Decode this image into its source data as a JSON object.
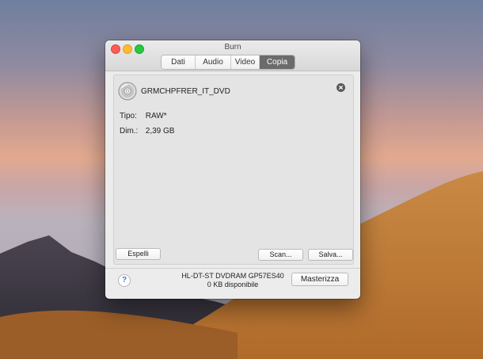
{
  "window": {
    "title": "Burn",
    "tabs": [
      {
        "label": "Dati",
        "active": false
      },
      {
        "label": "Audio",
        "active": false
      },
      {
        "label": "Video",
        "active": false
      },
      {
        "label": "Copia",
        "active": true
      }
    ]
  },
  "disc": {
    "name": "GRMCHPFRER_IT_DVD",
    "type_label": "Tipo:",
    "type_value": "RAW*",
    "size_label": "Dim.:",
    "size_value": "2,39 GB"
  },
  "buttons": {
    "eject": "Espelli",
    "scan": "Scan...",
    "save": "Salva...",
    "burn": "Masterizza",
    "help": "?"
  },
  "drive": {
    "name": "HL-DT-ST DVDRAM GP57ES40",
    "free": "0 KB disponibile"
  },
  "icons": {
    "disc": "disc-icon",
    "remove": "remove-circle-icon",
    "help": "help-icon"
  },
  "colors": {
    "active_tab": "#6b6b6b",
    "close": "#fc5d57",
    "minimize": "#fdbc2e",
    "maximize": "#28c840"
  }
}
